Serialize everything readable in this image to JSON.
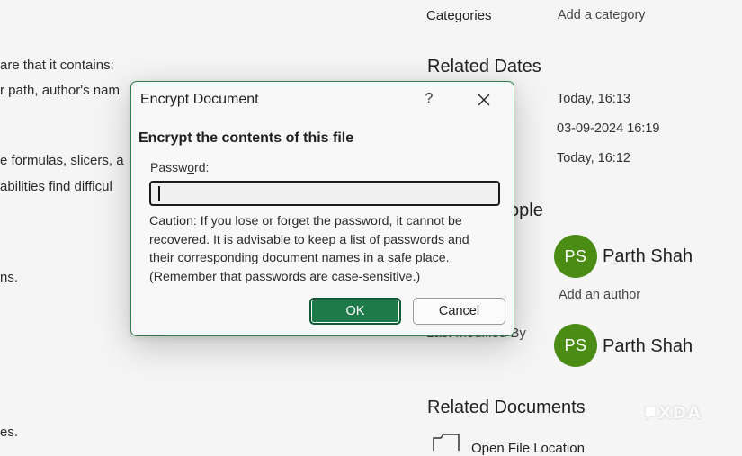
{
  "background": {
    "left_lines": [
      "are that it contains:",
      "r path, author's nam",
      "e formulas, slicers, a",
      "abilities find difficul",
      "ns.",
      "es."
    ],
    "properties": {
      "categories_label": "Categories",
      "categories_value": "Add a category"
    },
    "related_dates": {
      "heading": "Related Dates",
      "values": [
        "Today, 16:13",
        "03-09-2024 16:19",
        "Today, 16:12"
      ]
    },
    "related_people": {
      "heading_visible": "ople",
      "author": {
        "initials": "PS",
        "name": "Parth Shah"
      },
      "add_author": "Add an author",
      "last_modified_label": "Last Modified By",
      "last_modified_by": {
        "initials": "PS",
        "name": "Parth Shah"
      }
    },
    "related_documents": {
      "heading": "Related Documents",
      "open_file_location": "Open File Location"
    },
    "avatar_color": "#4a8c14",
    "watermark": "XDA"
  },
  "dialog": {
    "title": "Encrypt Document",
    "help_label": "?",
    "heading": "Encrypt the contents of this file",
    "password_label_pre": "Passw",
    "password_label_accel": "o",
    "password_label_post": "rd:",
    "password_value": "",
    "caution": "Caution: If you lose or forget the password, it cannot be recovered. It is advisable to keep a list of passwords and their corresponding document names in a safe place. (Remember that passwords are case-sensitive.)",
    "ok_label": "OK",
    "cancel_label": "Cancel",
    "accent_color": "#1f7a4a"
  }
}
